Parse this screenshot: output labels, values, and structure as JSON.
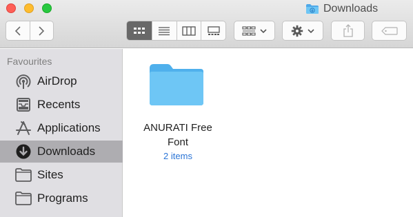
{
  "window": {
    "title": "Downloads",
    "title_icon": "downloads-folder-icon"
  },
  "toolbar": {
    "back_icon": "chevron-left-icon",
    "forward_icon": "chevron-right-icon",
    "views": [
      "icon-view-icon",
      "list-view-icon",
      "column-view-icon",
      "gallery-view-icon"
    ],
    "active_view": "icon-view-icon",
    "group_icon": "group-by-icon",
    "action_icon": "gear-icon",
    "share_icon": "share-icon",
    "tag_icon": "tag-icon"
  },
  "sidebar": {
    "heading": "Favourites",
    "items": [
      {
        "label": "AirDrop",
        "icon": "airdrop-icon"
      },
      {
        "label": "Recents",
        "icon": "recents-icon"
      },
      {
        "label": "Applications",
        "icon": "applications-icon"
      },
      {
        "label": "Downloads",
        "icon": "downloads-icon",
        "selected": true
      },
      {
        "label": "Sites",
        "icon": "folder-icon"
      },
      {
        "label": "Programs",
        "icon": "folder-icon"
      }
    ]
  },
  "content": {
    "items": [
      {
        "name_line1": "ANURATI Free",
        "name_line2": "Font",
        "count": "2 items",
        "icon": "folder-icon"
      }
    ]
  },
  "colors": {
    "folder": "#6ec6f5",
    "selected_sidebar": "#aeadb1",
    "count_text": "#2a74d6"
  }
}
